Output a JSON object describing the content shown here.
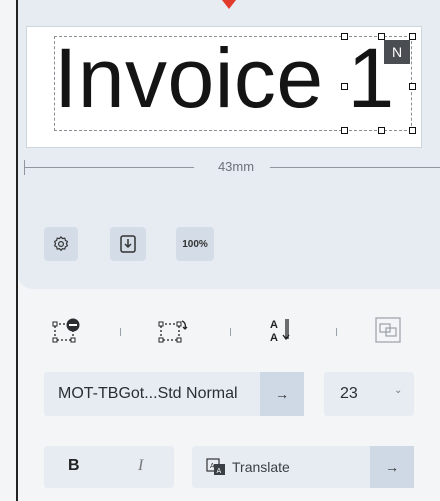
{
  "label": {
    "text": "Invoice 1",
    "badge": "N"
  },
  "dimension": {
    "value": "43mm"
  },
  "tools": {
    "zoom_label": "100%"
  },
  "font": {
    "name": "MOT-TBGot...Std Normal",
    "apply_arrow": "→"
  },
  "size": {
    "value": "23",
    "chevron": "⌄"
  },
  "style": {
    "bold": "B",
    "italic": "I"
  },
  "translate": {
    "label": "Translate",
    "arrow": "→"
  },
  "icons": [
    "settings-icon",
    "download-icon",
    "delete-frame-icon",
    "rotate-frame-icon",
    "text-direction-icon",
    "layers-icon"
  ],
  "colors": {
    "accent_marker": "#e23b2e",
    "panel": "#e7ecf3",
    "button": "#cfd9e5"
  }
}
